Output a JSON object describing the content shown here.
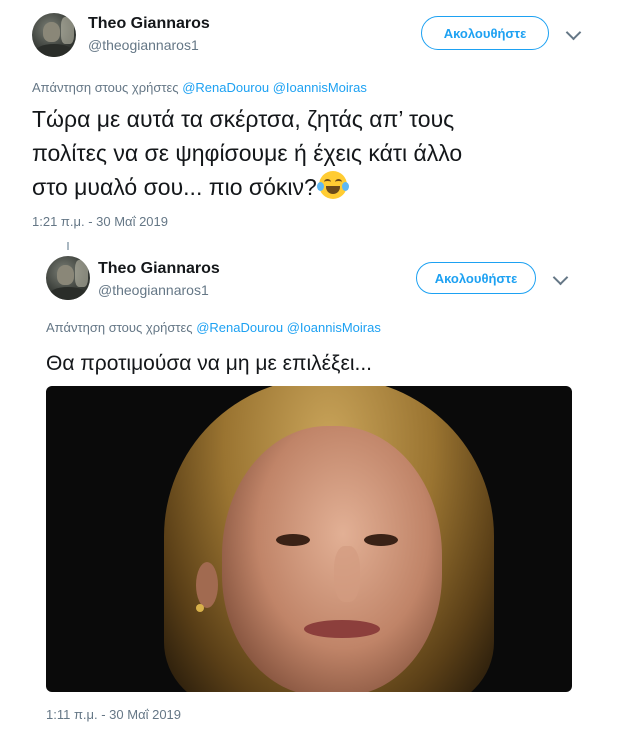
{
  "tweets": [
    {
      "name": "Theo Giannaros",
      "handle": "@theogiannaros1",
      "follow_label": "Ακολουθήστε",
      "reply_prefix": "Απάντηση στους χρήστες",
      "mentions": [
        "@RenaDourou",
        "@IoannisMoiras"
      ],
      "text_lines": [
        "Τώρα με αυτά τα σκέρτσα, ζητάς απ’ τους",
        "πολίτες να σε ψηφίσουμε ή έχεις κάτι άλλο",
        "στο μυαλό σου... πιο σόκιν?"
      ],
      "emoji_icon": "tears-of-joy-emoji-icon",
      "timestamp": "1:21 π.μ. - 30 Μαΐ 2019"
    },
    {
      "name": "Theo Giannaros",
      "handle": "@theogiannaros1",
      "follow_label": "Ακολουθήστε",
      "reply_prefix": "Απάντηση στους χρήστες",
      "mentions": [
        "@RenaDourou",
        "@IoannisMoiras"
      ],
      "text": "Θα προτιμούσα να μη με επιλέξει...",
      "timestamp": "1:11 π.μ. - 30 Μαΐ 2019"
    }
  ],
  "colors": {
    "accent": "#1da1f2",
    "secondary_text": "#657786",
    "primary_text": "#14171a"
  }
}
